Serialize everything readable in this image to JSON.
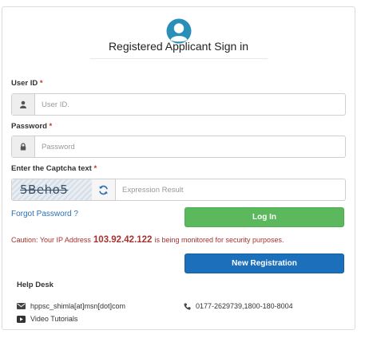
{
  "header": {
    "title": "Registered Applicant Sign in",
    "avatar_icon": "user-circle-icon"
  },
  "form": {
    "user_id": {
      "label": "User ID",
      "required_mark": "*",
      "placeholder": "User ID.",
      "value": "",
      "icon": "user-icon"
    },
    "password": {
      "label": "Password",
      "required_mark": "*",
      "placeholder": "Password",
      "value": "",
      "icon": "lock-icon"
    },
    "captcha": {
      "label": "Enter the Captcha text",
      "required_mark": "*",
      "image_text": "5Beho5",
      "placeholder": "Expression Result",
      "value": "",
      "refresh_icon": "refresh-icon"
    }
  },
  "links": {
    "forgot_password": "Forgot Password ?"
  },
  "buttons": {
    "login": "Log In",
    "new_registration": "New Registration"
  },
  "caution": {
    "prefix": "Caution: Your IP Address",
    "ip": "103.92.42.122",
    "suffix": "is being monitored for security purposes."
  },
  "help_desk": {
    "title": "Help Desk",
    "email": "hppsc_shimla[at]msn[dot]com",
    "phone": "0177-2629739,1800-180-8004",
    "video": "Video Tutorials"
  },
  "colors": {
    "login": "#5cb85c",
    "registration": "#1b6fbb",
    "caution": "#a8322d",
    "avatar": "#2a8fb8"
  }
}
